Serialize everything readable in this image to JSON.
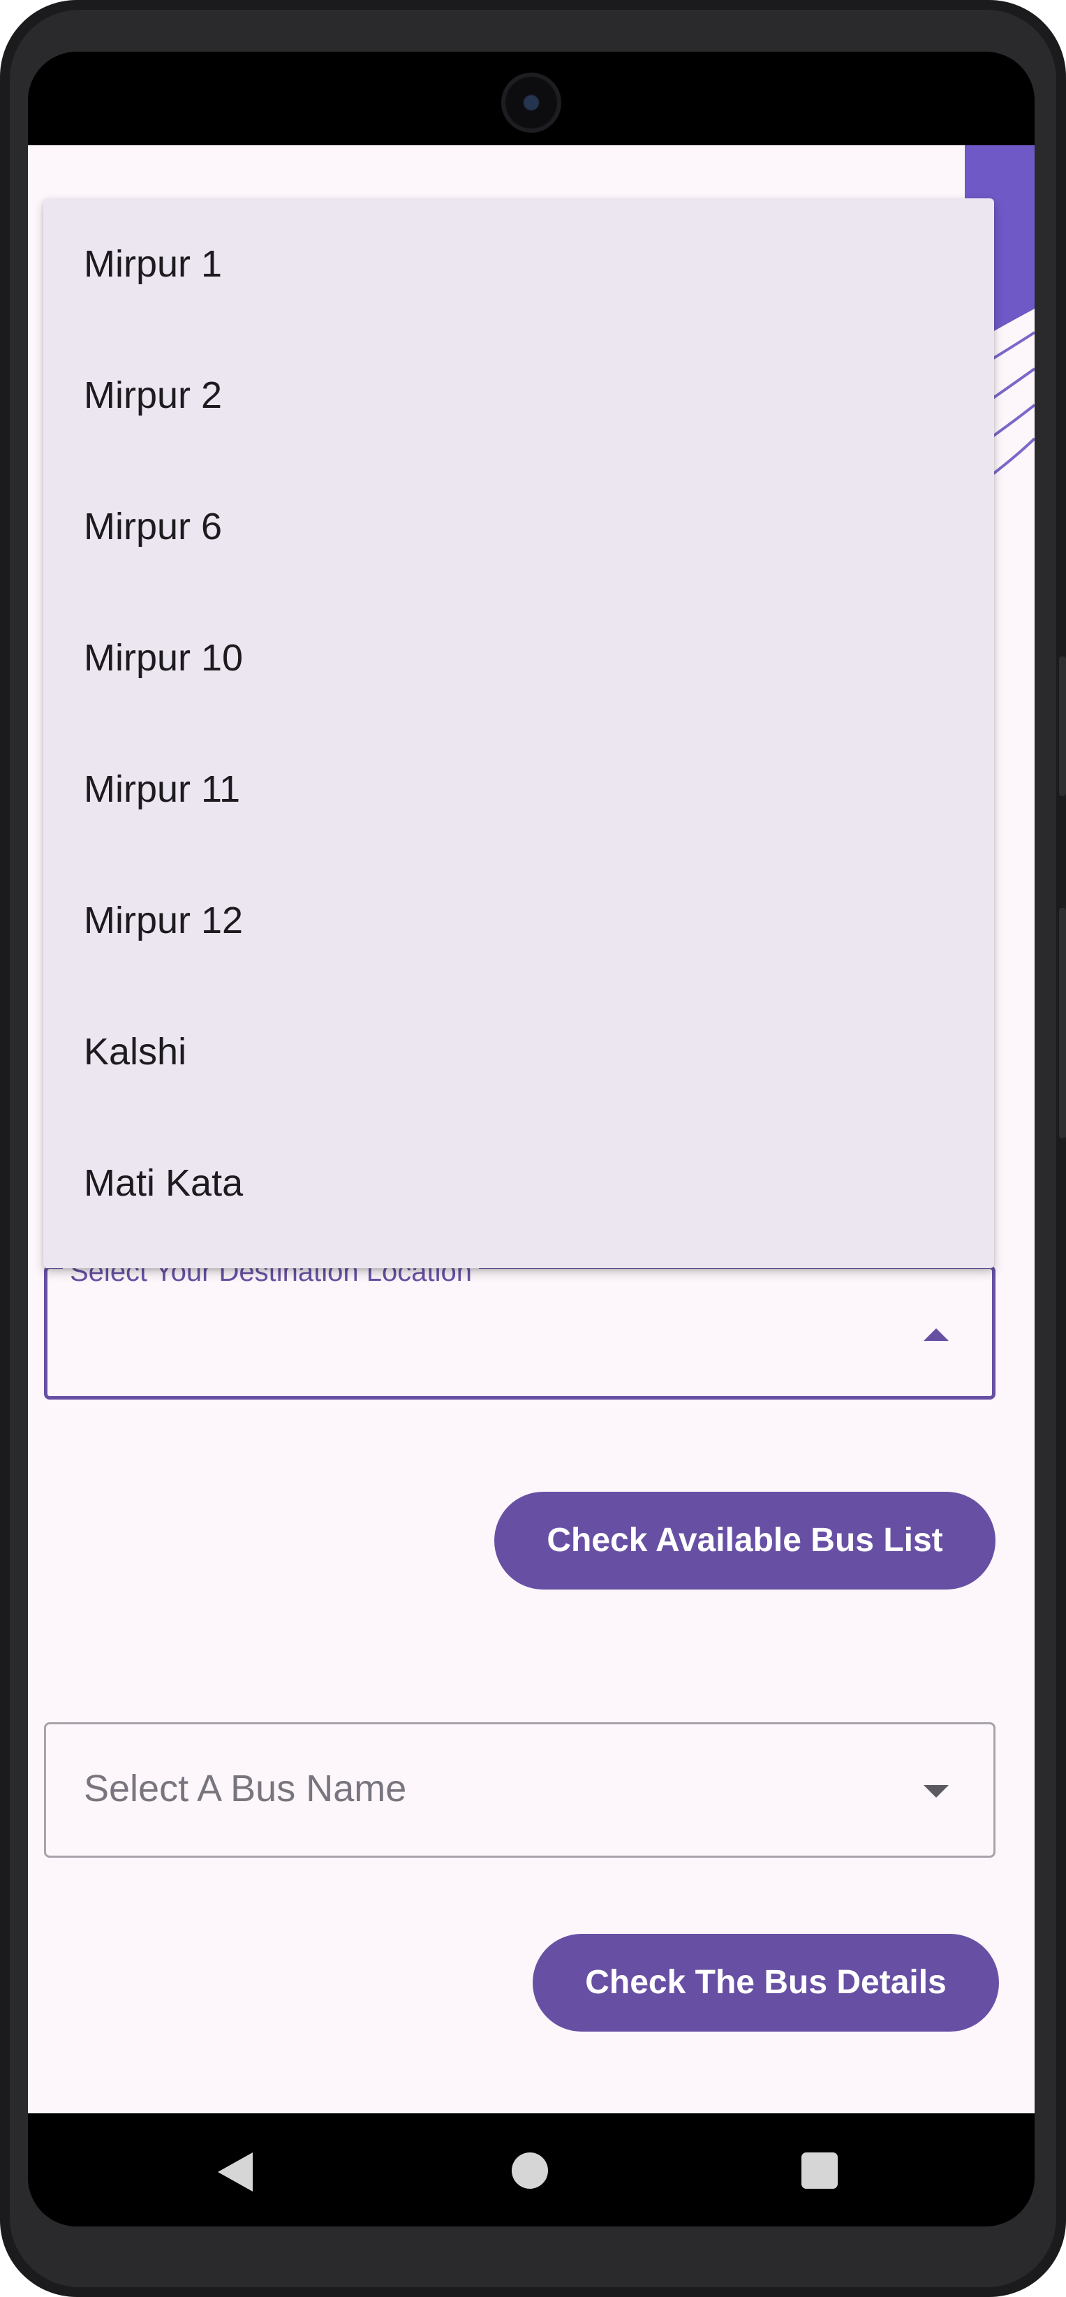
{
  "dropdown": {
    "items": [
      {
        "label": "Mirpur 1"
      },
      {
        "label": "Mirpur 2"
      },
      {
        "label": "Mirpur 6"
      },
      {
        "label": "Mirpur 10"
      },
      {
        "label": "Mirpur 11"
      },
      {
        "label": "Mirpur 12"
      },
      {
        "label": "Kalshi"
      },
      {
        "label": "Mati Kata"
      }
    ]
  },
  "destination_field": {
    "label": "Select Your Destination Location",
    "value": "",
    "icon": "arrow-drop-up-icon"
  },
  "check_bus_list_button": {
    "label": "Check Available Bus List"
  },
  "bus_name_field": {
    "placeholder": "Select A Bus Name",
    "icon": "arrow-drop-down-icon"
  },
  "check_bus_details_button": {
    "label": "Check The Bus Details"
  },
  "colors": {
    "primary": "#6750a4",
    "background": "#fdf7fb",
    "menu_surface": "#ece6f0",
    "outline": "#a8a3ab",
    "text": "#1d1b20"
  },
  "navigation_bar": {
    "back_icon": "back-triangle-icon",
    "home_icon": "home-circle-icon",
    "recents_icon": "recents-square-icon"
  }
}
